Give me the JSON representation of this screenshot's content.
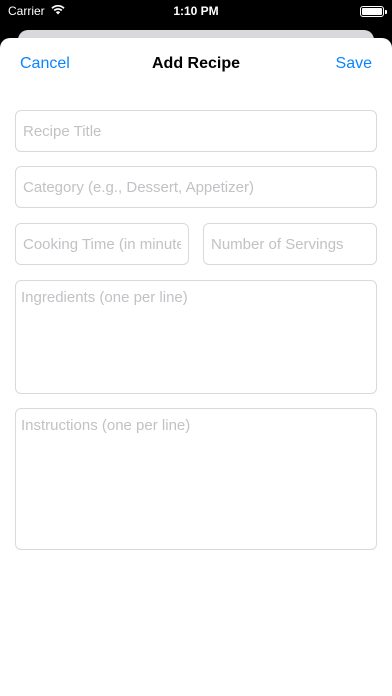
{
  "status_bar": {
    "carrier": "Carrier",
    "time": "1:10 PM",
    "icons": [
      "wifi-icon",
      "battery-icon"
    ]
  },
  "nav": {
    "cancel_label": "Cancel",
    "title": "Add Recipe",
    "save_label": "Save"
  },
  "form": {
    "title_placeholder": "Recipe Title",
    "category_placeholder": "Category (e.g., Dessert, Appetizer)",
    "time_placeholder": "Cooking Time (in minutes)",
    "servings_placeholder": "Number of Servings",
    "ingredients_placeholder": "Ingredients (one per line)",
    "instructions_placeholder": "Instructions (one per line)"
  },
  "colors": {
    "accent": "#0a84ff",
    "border": "#d9d9dd",
    "placeholder": "#c2c2c6"
  }
}
